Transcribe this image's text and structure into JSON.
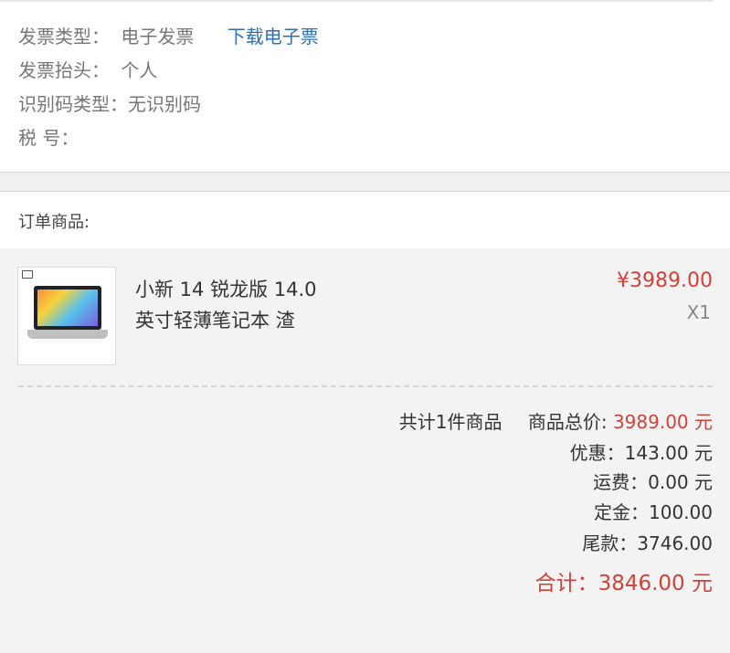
{
  "invoice": {
    "type_label": "发票类型：",
    "type_value": "电子发票",
    "download_link": "下载电子票",
    "header_label": "发票抬头：",
    "header_value": "个人",
    "id_type_label": "识别码类型：",
    "id_type_value": "无识别码",
    "tax_no_label": "税 号："
  },
  "order": {
    "section_label": "订单商品:",
    "product": {
      "title_line1": "小新 14 锐龙版 14.0",
      "title_line2": "英寸轻薄笔记本 渣",
      "price": "¥3989.00",
      "quantity": "X1"
    },
    "summary": {
      "count_text": "共计1件商品",
      "total_label": "商品总价:",
      "total_value": "3989.00 元",
      "discount": "优惠：143.00 元",
      "shipping": "运费：0.00 元",
      "deposit": "定金：100.00",
      "balance": "尾款：3746.00",
      "grand_total": "合计：3846.00 元"
    }
  },
  "colors": {
    "accent_red": "#d0423a",
    "link_blue": "#2f6fb3"
  }
}
